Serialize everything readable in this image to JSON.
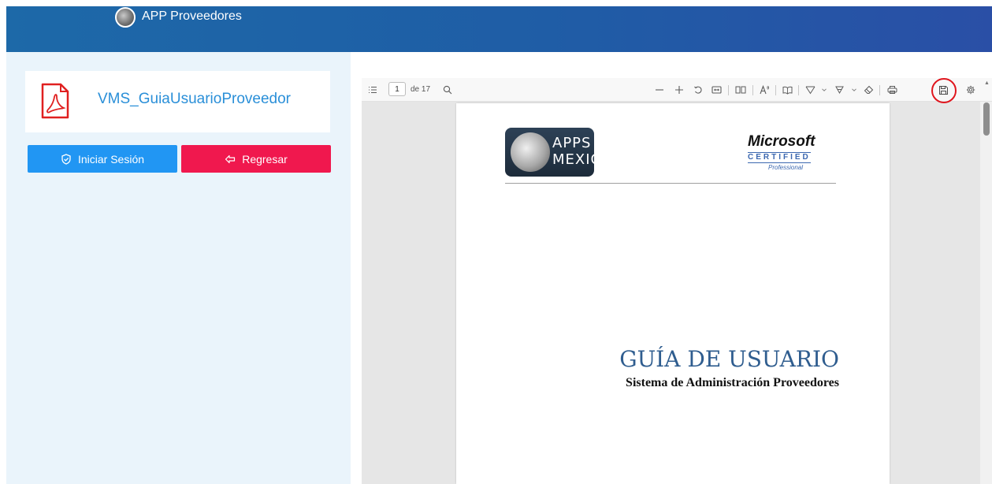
{
  "header": {
    "title": "APP Proveedores",
    "logo_icon": "globe-emblem-icon"
  },
  "file": {
    "name": "VMS_GuiaUsuarioProveedor",
    "icon": "pdf-icon",
    "icon_color": "#e02020"
  },
  "actions": {
    "login_label": "Iniciar Sesión",
    "back_label": "Regresar",
    "login_color": "#2196f3",
    "back_color": "#f0184e"
  },
  "viewer": {
    "current_page": "1",
    "total_pages": "de 17",
    "toolbar_icons": [
      "outline-icon",
      "search-icon",
      "zoom-out-icon",
      "zoom-in-icon",
      "rotate-icon",
      "fit-width-icon",
      "page-view-icon",
      "read-aloud-icon",
      "immersive-reader-icon",
      "draw-icon",
      "highlight-icon",
      "erase-icon",
      "print-icon",
      "save-icon",
      "settings-icon"
    ]
  },
  "document": {
    "logo_text_line1": "APPS",
    "logo_text_line2": "MEXICO",
    "ms_brand": "Microsoft",
    "ms_certified": "CERTIFIED",
    "ms_professional": "Professional",
    "title": "GUÍA DE USUARIO",
    "subtitle": "Sistema de Administración Proveedores"
  }
}
